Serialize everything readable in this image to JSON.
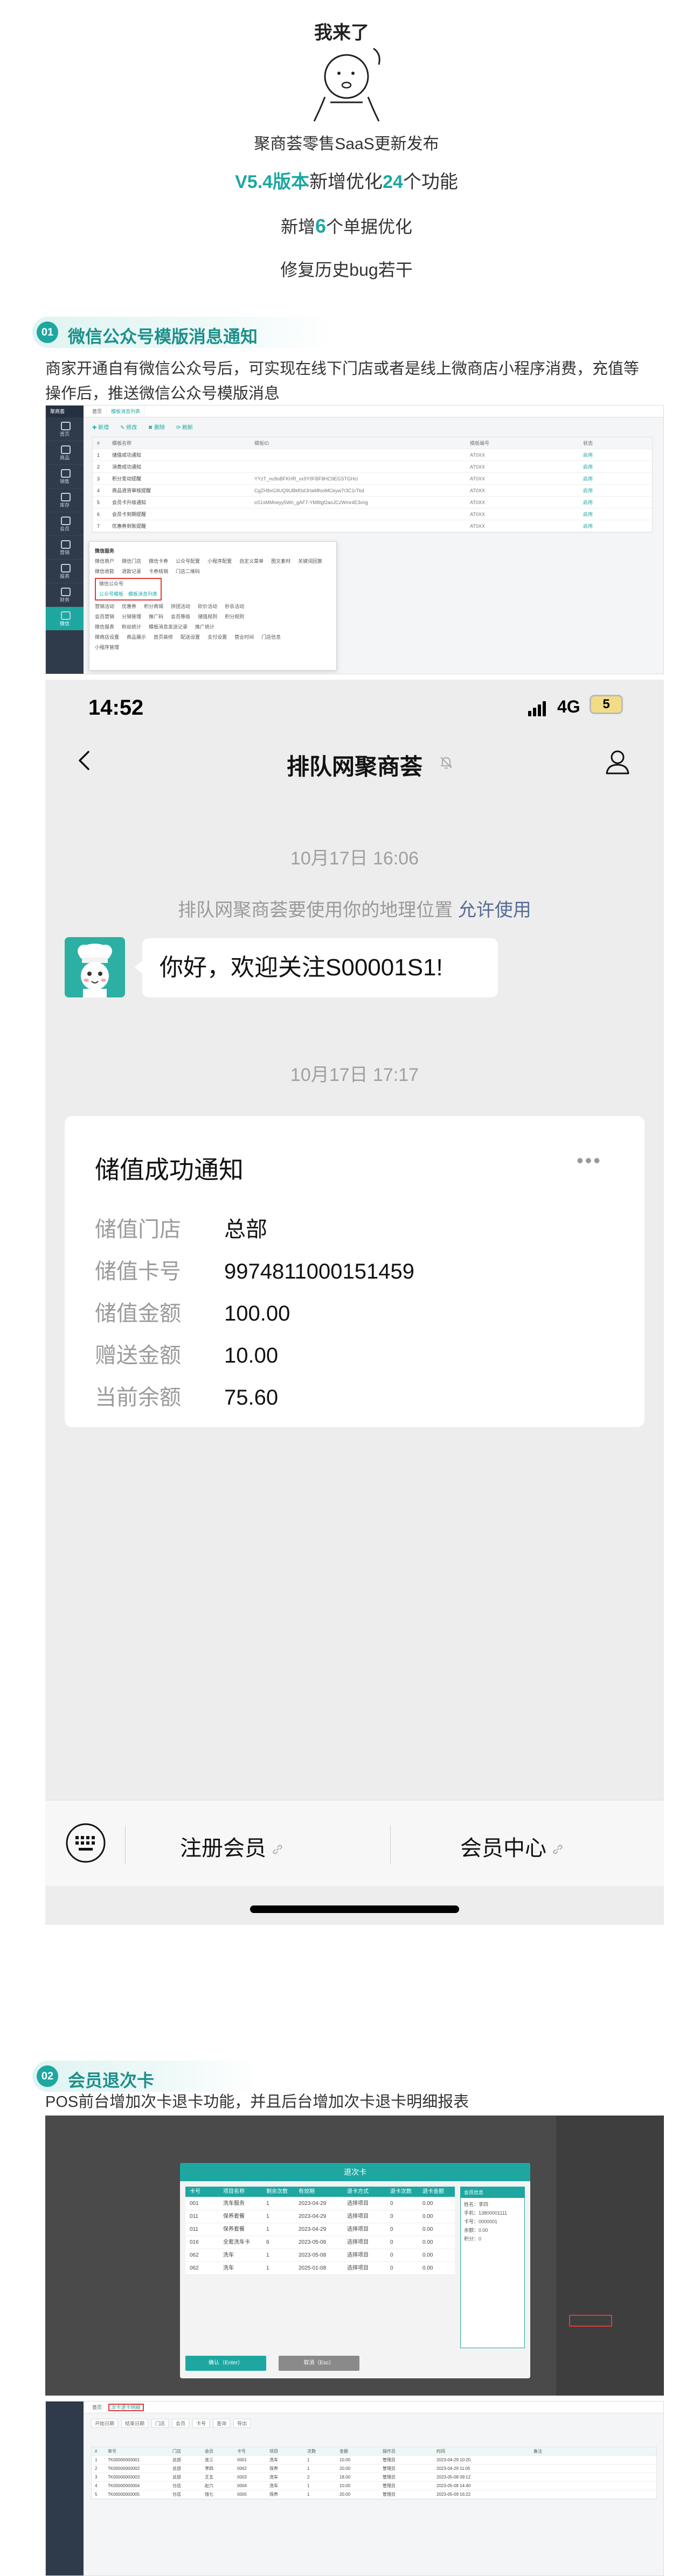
{
  "hero": {
    "mascot_text": "我来了",
    "line1": "聚商荟零售SaaS更新发布",
    "line2_em": "V5.4版本",
    "line2_mid": "新增优化",
    "line2_num": "24",
    "line2_tail": "个功能",
    "line3_pre": "新增",
    "line3_num": "6",
    "line3_tail": "个单据优化",
    "line4": "修复历史bug若干"
  },
  "section1": {
    "num": "01",
    "title": "微信公众号模版消息通知",
    "text": "商家开通自有微信公众号后，可实现在线下门店或者是线上微商店小程序消费，充值等操作后，推送微信公众号模版消息",
    "admin": {
      "logo": "聚商荟",
      "tabs": [
        "首页",
        "模板消息列表"
      ],
      "toolbar": [
        "✚ 新增",
        "✎ 修改",
        "✖ 删除",
        "⟳ 刷新"
      ],
      "nav": [
        "首页",
        "商品",
        "销售",
        "库存",
        "会员",
        "营销",
        "报表",
        "财务",
        "设置",
        "微信"
      ],
      "table_header": [
        "#",
        "模板名称",
        "模板ID",
        "模板编号",
        "状态"
      ],
      "rows": [
        [
          "1",
          "储值成功通知",
          "",
          "AT0XX",
          "启用"
        ],
        [
          "2",
          "消费成功通知",
          "",
          "AT0XX",
          "启用"
        ],
        [
          "3",
          "积分变动提醒",
          "YYzT_nu9oBFKHR_xx9Y0FBF8HC9EGSTGHcl",
          "AT0XX",
          "启用"
        ],
        [
          "4",
          "商品退货审核提醒",
          "CgZH8xG9UQ9UBkf0sfJHaMfooMCeyw7r3C1rTkd",
          "AT0XX",
          "启用"
        ],
        [
          "5",
          "会员卡升级通知",
          "oS1sMMneyy5Wri_gAF7-YM8tgf2aoJCzWmr4E3vng",
          "AT0XX",
          "启用"
        ],
        [
          "6",
          "会员卡到期提醒",
          "",
          "AT0XX",
          "启用"
        ],
        [
          "7",
          "优惠券到账提醒",
          "",
          "AT0XX",
          "启用"
        ]
      ],
      "popup": {
        "title": "微信服务",
        "lines": [
          [
            "微信商户",
            "微信门店",
            "微信卡券",
            "公众号配置",
            "小程序配置",
            "自定义菜单",
            "图文素材",
            "关键词回复"
          ],
          [
            "微信收款",
            "退款记录",
            "卡券核销",
            "门店二维码"
          ]
        ],
        "red_items": [
          "微信公众号",
          "公众号模板",
          "模板消息列表"
        ],
        "rest": [
          [
            "营销活动",
            "优惠券",
            "积分商城",
            "拼团活动",
            "砍价活动",
            "秒杀活动"
          ],
          [
            "会员营销",
            "分销管理",
            "推广码",
            "会员等级",
            "储值规则",
            "积分规则"
          ],
          [
            "微信报表",
            "粉丝统计",
            "模板消息发送记录",
            "推广统计"
          ],
          [
            "微商店设置",
            "商品展示",
            "首页装修",
            "配送设置",
            "支付设置",
            "营业时间",
            "门店信息"
          ],
          [
            "小程序管理"
          ]
        ]
      }
    },
    "phone": {
      "time": "14:52",
      "network": "4G",
      "battery": "5",
      "chat_title": "排队网聚商荟",
      "time1": "10月17日 16:06",
      "location_msg": "排队网聚商荟要使用你的地理位置",
      "location_link": "允许使用",
      "welcome": "你好，欢迎关注S00001S1!",
      "time2": "10月17日 17:17",
      "card_title": "储值成功通知",
      "card_more": "•••",
      "fields": [
        {
          "label": "储值门店",
          "value": "总部"
        },
        {
          "label": "储值卡号",
          "value": "9974811000151459"
        },
        {
          "label": "储值金额",
          "value": "100.00"
        },
        {
          "label": "赠送金额",
          "value": "10.00"
        },
        {
          "label": "当前余额",
          "value": "75.60"
        }
      ],
      "menu1": "注册会员",
      "menu2": "会员中心"
    }
  },
  "section2": {
    "num": "02",
    "title": "会员退次卡",
    "text": "POS前台增加次卡退卡功能，并且后台增加次卡退卡明细报表",
    "pos": {
      "modal_title": "退次卡",
      "headers": [
        "卡号",
        "项目名称",
        "剩余次数",
        "有效期",
        "退卡方式",
        "退卡次数",
        "退卡金额"
      ],
      "rows": [
        [
          "001",
          "洗车服务",
          "1",
          "2023-04-29",
          "选择项目",
          "0",
          "0.00"
        ],
        [
          "011",
          "保养套餐",
          "1",
          "2023-04-29",
          "选择项目",
          "0",
          "0.00"
        ],
        [
          "011",
          "保养套餐",
          "1",
          "2023-04-29",
          "选择项目",
          "0",
          "0.00"
        ],
        [
          "016",
          "全套洗车卡",
          "6",
          "2023-05-08",
          "选择项目",
          "0",
          "0.00"
        ],
        [
          "062",
          "洗车",
          "1",
          "2023-05-08",
          "选择项目",
          "0",
          "0.00"
        ],
        [
          "062",
          "洗车",
          "1",
          "2025-01-08",
          "选择项目",
          "0",
          "0.00"
        ]
      ],
      "info_title": "会员信息",
      "info_lines": [
        "姓名：李四",
        "手机：13800001111",
        "卡号：0000001",
        "余额：0.00",
        "积分：0"
      ],
      "ok_btn": "确认（Enter）",
      "cancel_btn": "取消（Esc）",
      "side_items": [
        "退次卡"
      ]
    },
    "admin": {
      "tabs": [
        "首页",
        "次卡退卡明细"
      ],
      "filters": [
        "开始日期",
        "结束日期",
        "门店",
        "会员",
        "卡号",
        "查询",
        "导出"
      ],
      "headers": [
        "#",
        "单号",
        "门店",
        "会员",
        "卡号",
        "项目",
        "次数",
        "金额",
        "操作员",
        "时间",
        "备注"
      ],
      "rows": [
        [
          "1",
          "TK00000000001",
          "总部",
          "张三",
          "0001",
          "洗车",
          "1",
          "10.00",
          "管理员",
          "2023-04-29 10:20",
          ""
        ],
        [
          "2",
          "TK00000000002",
          "总部",
          "李四",
          "0002",
          "保养",
          "1",
          "20.00",
          "管理员",
          "2023-04-29 11:05",
          ""
        ],
        [
          "3",
          "TK00000000003",
          "总部",
          "王五",
          "0003",
          "洗车",
          "2",
          "18.00",
          "管理员",
          "2023-05-08 09:12",
          ""
        ],
        [
          "4",
          "TK00000000004",
          "分店",
          "赵六",
          "0004",
          "洗车",
          "1",
          "10.00",
          "管理员",
          "2023-05-08 14:40",
          ""
        ],
        [
          "5",
          "TK00000000005",
          "分店",
          "钱七",
          "0005",
          "保养",
          "1",
          "20.00",
          "管理员",
          "2023-05-09 16:22",
          ""
        ]
      ]
    }
  },
  "colors": {
    "accent": "#1ea7a1",
    "red": "#e53935",
    "link": "#576b95"
  },
  "icons": [
    "back-arrow-icon",
    "mute-bell-icon",
    "person-icon",
    "keyboard-icon",
    "link-icon",
    "signal-icon",
    "battery-icon"
  ]
}
